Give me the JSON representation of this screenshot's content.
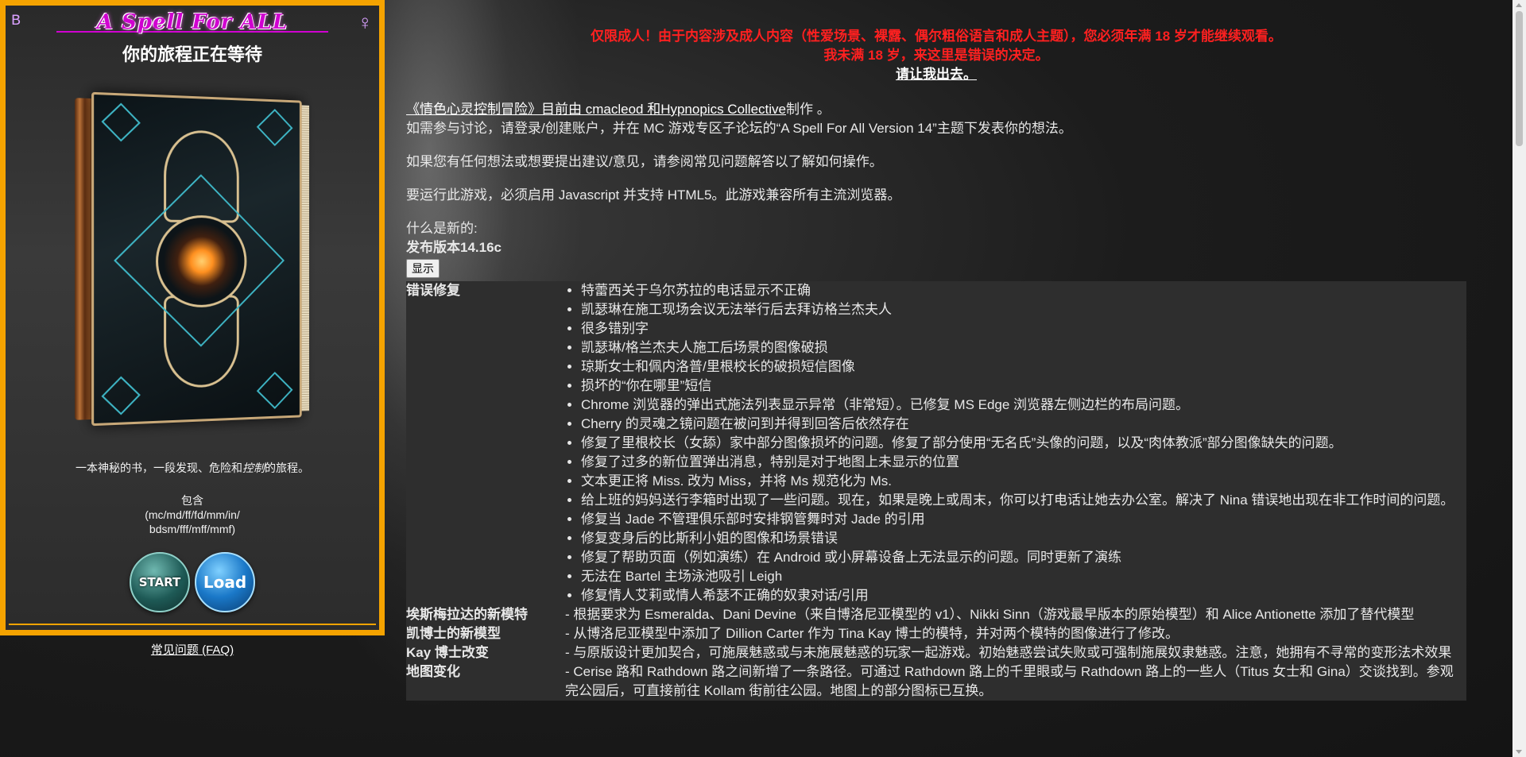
{
  "left_panel": {
    "logo_text": "A Spell For ALL",
    "journey_title": "你的旅程正在等待",
    "tagline_prefix": "一本神秘的书，一段发现、危险和",
    "tagline_em": "控制",
    "tagline_suffix": "的旅程。",
    "includes_label": "包含",
    "includes_line1": "(mc/md/ff/fd/mm/in/",
    "includes_line2": "bdsm/fff/mff/mmf)",
    "start_label": "START",
    "load_label": "Load",
    "faq_link": "常见问题 (FAQ)"
  },
  "warning": {
    "line1": "仅限成人！由于内容涉及成人内容（性爱场景、裸露、偶尔粗俗语言和成人主题），您必须年满 18 岁才能继续观看。",
    "line2": "我未满 18 岁，来这里是错误的决定。",
    "exit": "请让我出去。"
  },
  "intro": {
    "credit_title": "《情色心灵控制冒险》目前由 cmacleod 和Hypnopics Collective",
    "credit_suffix": "制作 。",
    "discuss": "如需参与讨论，请登录/创建账户，并在 MC 游戏专区子论坛的“A Spell For All Version 14”主题下发表你的想法。",
    "faq_hint": "如果您有任何想法或想要提出建议/意见，请参阅常见问题解答以了解如何操作。",
    "requirements": "要运行此游戏，必须启用 Javascript 并支持 HTML5。此游戏兼容所有主流浏览器。",
    "whats_new": "什么是新的:",
    "release": "发布版本14.16c",
    "show_button": "显示"
  },
  "changelog": {
    "bugfix_head": "错误修复",
    "bugfixes": [
      "特蕾西关于乌尔苏拉的电话显示不正确",
      "凯瑟琳在施工现场会议无法举行后去拜访格兰杰夫人",
      "很多错别字",
      "凯瑟琳/格兰杰夫人施工后场景的图像破损",
      "琼斯女士和佩内洛普/里根校长的破损短信图像",
      "损坏的“你在哪里”短信",
      "Chrome 浏览器的弹出式施法列表显示异常（非常短）。已修复 MS Edge 浏览器左侧边栏的布局问题。",
      "Cherry 的灵魂之镜问题在被问到并得到回答后依然存在",
      "修复了里根校长（女舔）家中部分图像损坏的问题。修复了部分使用“无名氏”头像的问题，以及“肉体教派”部分图像缺失的问题。",
      "修复了过多的新位置弹出消息，特别是对于地图上未显示的位置",
      "文本更正将 Miss. 改为 Miss，并将 Ms 规范化为 Ms.",
      "给上班的妈妈送行李箱时出现了一些问题。现在，如果是晚上或周末，你可以打电话让她去办公室。解决了 Nina 错误地出现在非工作时间的问题。",
      "修复当 Jade 不管理俱乐部时安排钢管舞时对 Jade 的引用",
      "修复变身后的比斯利小姐的图像和场景错误",
      "修复了帮助页面（例如演练）在 Android 或小屏幕设备上无法显示的问题。同时更新了演练",
      "无法在 Bartel 主场泳池吸引 Leigh",
      "修复情人艾莉或情人希瑟不正确的奴隶对话/引用"
    ],
    "rows": [
      {
        "head": "埃斯梅拉达的新模特",
        "body": "- 根据要求为 Esmeralda、Dani Devine（来自博洛尼亚模型的 v1）、Nikki Sinn（游戏最早版本的原始模型）和 Alice Antionette 添加了替代模型"
      },
      {
        "head": "凯博士的新模型",
        "body": "- 从博洛尼亚模型中添加了 Dillion Carter 作为 Tina Kay 博士的模特，并对两个模特的图像进行了修改。"
      },
      {
        "head": "Kay 博士改变",
        "body": "- 与原版设计更加契合，可施展魅惑或与未施展魅惑的玩家一起游戏。初始魅惑尝试失败或可强制施展奴隶魅惑。注意，她拥有不寻常的变形法术效果"
      },
      {
        "head": "地图变化",
        "body": "- Cerise 路和 Rathdown 路之间新增了一条路径。可通过 Rathdown 路上的千里眼或与 Rathdown 路上的一些人（Titus 女士和 Gina）交谈找到。参观完公园后，可直接前往 Kollam 街前往公园。地图上的部分图标已互换。"
      }
    ]
  }
}
